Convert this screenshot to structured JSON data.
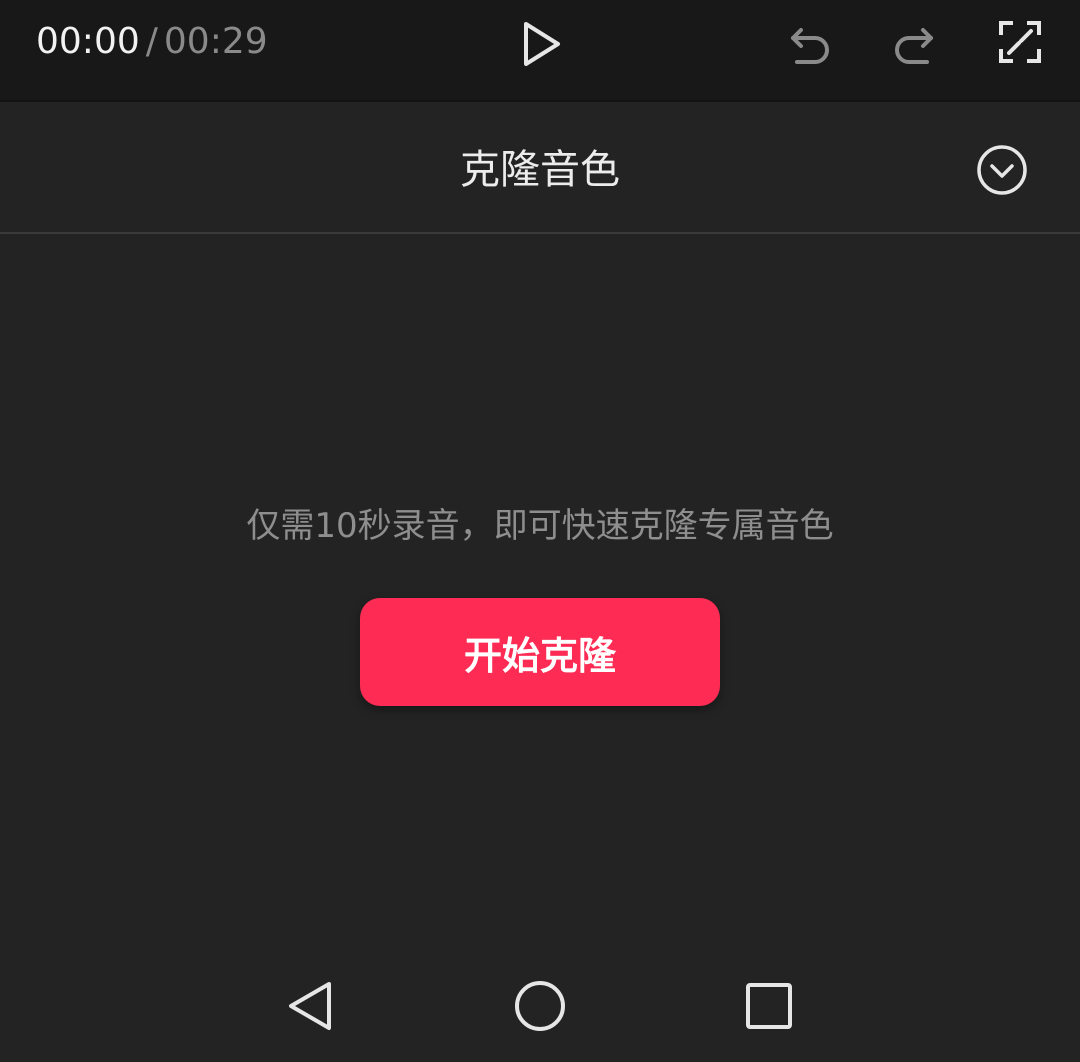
{
  "player": {
    "current_time": "00:00",
    "separator": "/",
    "total_time": "00:29",
    "icons": {
      "play": "play-icon",
      "undo": "undo-icon",
      "redo": "redo-icon",
      "fullscreen": "fullscreen-icon"
    }
  },
  "panel": {
    "title": "克隆音色",
    "collapse_icon": "chevron-down-circle-icon"
  },
  "main": {
    "hint": "仅需10秒录音，即可快速克隆专属音色",
    "start_button_label": "开始克隆"
  },
  "nav_bar": {
    "icons": [
      "back-triangle-icon",
      "home-circle-icon",
      "recents-square-icon"
    ]
  },
  "colors": {
    "background": "#232323",
    "player_bar": "#181818",
    "accent": "#fe2c55",
    "text_primary": "#ececec",
    "text_secondary": "#8e8e8e"
  }
}
